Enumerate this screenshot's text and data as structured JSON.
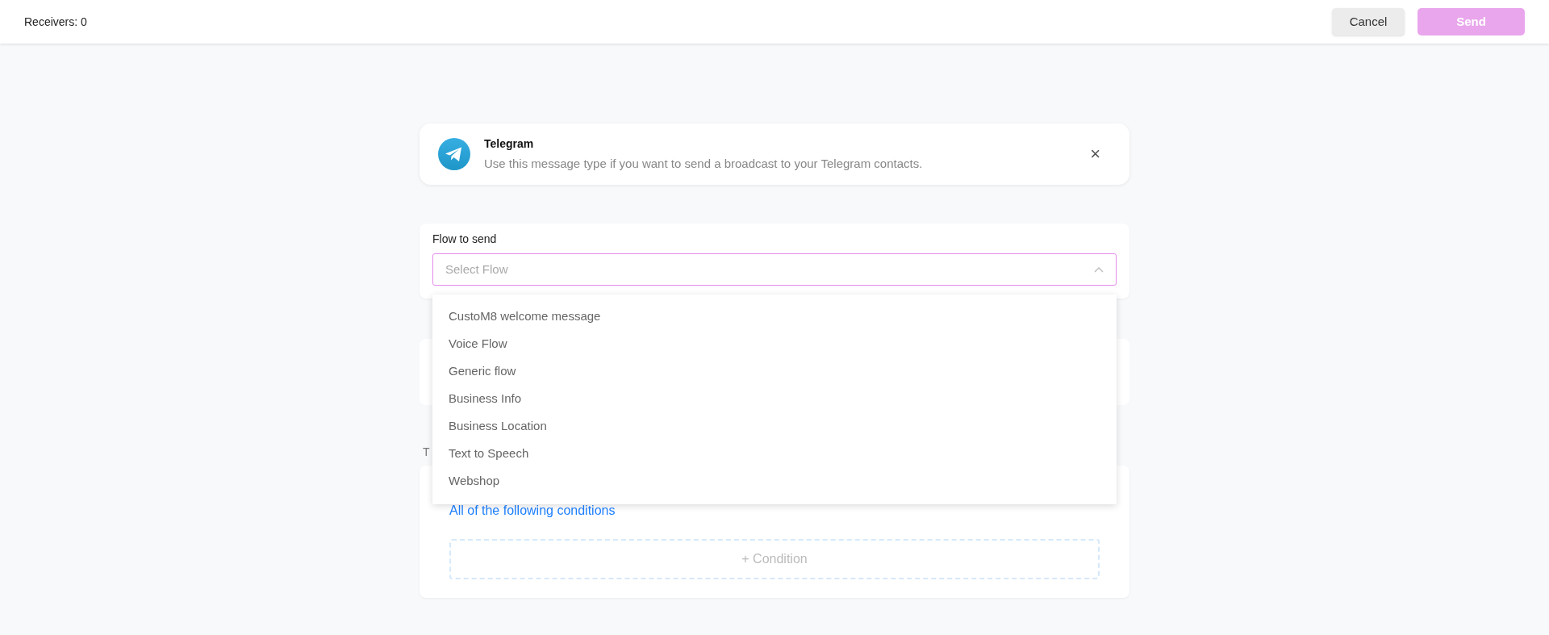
{
  "header": {
    "receivers": "Receivers: 0",
    "buttons": [
      {
        "kind": "secondary",
        "label": "Cancel",
        "disabled": false
      },
      {
        "kind": "primary",
        "label": "Send",
        "disabled": true
      }
    ]
  },
  "channel_card": {
    "title": "Telegram",
    "description": "Use this message type if you want to send a broadcast to your Telegram contacts.",
    "close": "×"
  },
  "flow": {
    "label": "Flow to send",
    "placeholder": "Select Flow",
    "expanded": true,
    "options": [
      "CustoM8 welcome message",
      "Voice Flow",
      "Generic flow",
      "Business Info",
      "Business Location",
      "Text to Speech",
      "Webshop"
    ]
  },
  "targeting": {
    "label": "T",
    "match_link": "All of the following conditions",
    "add_condition": "+ Condition"
  }
}
